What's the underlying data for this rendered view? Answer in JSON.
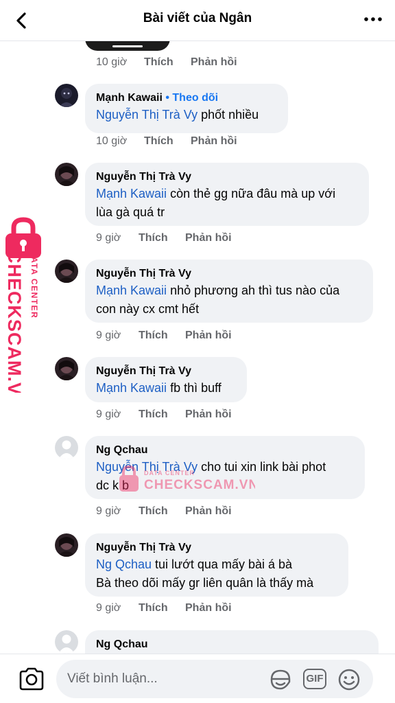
{
  "header": {
    "title": "Bài viết của Ngân"
  },
  "top_meta": {
    "time": "10 giờ",
    "like": "Thích",
    "reply": "Phản hồi"
  },
  "comments": [
    {
      "author": "Mạnh Kawaii",
      "follow": "Theo dõi",
      "mention": "Nguyễn Thị Trà Vy",
      "text": " phốt nhiều",
      "line2": "",
      "time": "10 giờ",
      "like": "Thích",
      "reply": "Phản hồi"
    },
    {
      "author": "Nguyễn Thị Trà Vy",
      "mention": "Mạnh Kawaii",
      "text": " còn thẻ gg nữa đâu mà up với",
      "line2": "lùa gà quá tr",
      "time": "9 giờ",
      "like": "Thích",
      "reply": "Phản hồi"
    },
    {
      "author": "Nguyễn Thị Trà Vy",
      "mention": "Mạnh Kawaii",
      "text": " nhỏ phương ah thì tus nào của",
      "line2": "con này cx cmt hết",
      "time": "9 giờ",
      "like": "Thích",
      "reply": "Phản hồi"
    },
    {
      "author": "Nguyễn Thị Trà Vy",
      "mention": "Mạnh Kawaii",
      "text": " fb thì buff",
      "line2": "",
      "time": "9 giờ",
      "like": "Thích",
      "reply": "Phản hồi"
    },
    {
      "author": "Ng Qchau",
      "mention": "Nguyễn Thị Trà Vy",
      "text": " cho tui xin link bài phot",
      "line2": "dc k b",
      "time": "9 giờ",
      "like": "Thích",
      "reply": "Phản hồi"
    },
    {
      "author": "Nguyễn Thị Trà Vy",
      "mention": "Ng Qchau",
      "text": " tui lướt qua mấy bài á bà",
      "line2": "Bà theo dõi mấy gr liên quân là thấy mà",
      "time": "9 giờ",
      "like": "Thích",
      "reply": "Phản hồi"
    },
    {
      "author": "Ng Qchau",
      "mention": "",
      "text": "",
      "line2": ""
    }
  ],
  "composer": {
    "placeholder": "Viết bình luận...",
    "gif_label": "GIF"
  },
  "watermark": {
    "side_small": "DATA CENTER",
    "side_brand": "CHECKSCAM.VN",
    "center_small": "DATA CENTER",
    "center_brand": "CHECKSCAM.VN"
  },
  "colors": {
    "mention": "#1d5fc4",
    "follow": "#1877f2",
    "bubble": "#f0f2f5",
    "muted": "#65676b",
    "watermark": "#ee2a5f"
  },
  "icons": [
    "back-arrow-icon",
    "more-dots-icon",
    "camera-icon",
    "sticker-icon",
    "gif-icon",
    "emoji-icon",
    "lock-icon"
  ]
}
